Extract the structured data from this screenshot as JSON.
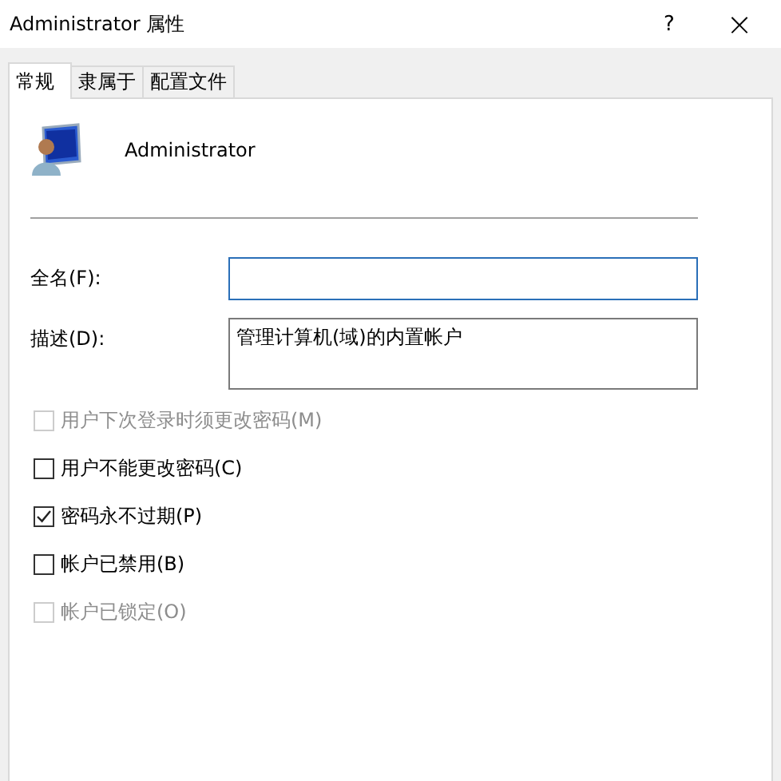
{
  "window": {
    "title": "Administrator 属性",
    "help": "?",
    "close": "×"
  },
  "tabs": [
    {
      "label": "常规",
      "selected": true
    },
    {
      "label": "隶属于",
      "selected": false
    },
    {
      "label": "配置文件",
      "selected": false
    }
  ],
  "user": {
    "name": "Administrator"
  },
  "fields": [
    {
      "label": "全名(F):",
      "focused": true,
      "kind": "single"
    },
    {
      "label": "描述(D):",
      "value": "管理计算机(域)的内置帐户",
      "focused": false,
      "kind": "multi"
    }
  ],
  "options": [
    {
      "label": "用户下次登录时须更改密码(M)",
      "checked": false,
      "disabled": true
    },
    {
      "label": "用户不能更改密码(C)",
      "checked": false,
      "disabled": false
    },
    {
      "label": "密码永不过期(P)",
      "checked": true,
      "disabled": false
    },
    {
      "label": "帐户已禁用(B)",
      "checked": false,
      "disabled": false
    },
    {
      "label": "帐户已锁定(O)",
      "checked": false,
      "disabled": true
    }
  ]
}
